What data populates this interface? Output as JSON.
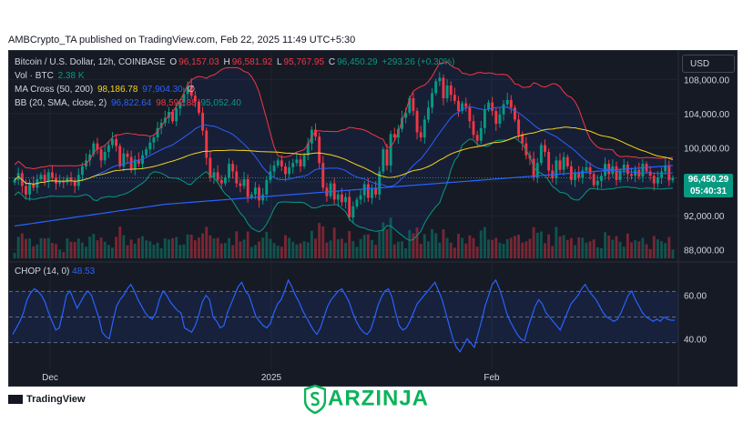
{
  "header": {
    "published": "AMBCrypto_TA published on TradingView.com, Feb 22, 2025 11:49 UTC+5:30"
  },
  "legend": {
    "symbol": "Bitcoin / U.S. Dollar, 12h, COINBASE",
    "o_label": "O",
    "o": "96,157.03",
    "h_label": "H",
    "h": "96,581.92",
    "l_label": "L",
    "l": "95,767.95",
    "c_label": "C",
    "c": "96,450.29",
    "change": "+293.26 (+0.30%)",
    "vol_label": "Vol · BTC",
    "vol": "2.38 K",
    "ma_label": "MA Cross (50, 200)",
    "ma1": "98,186.78",
    "ma2": "97,904.30",
    "ma3": "∅",
    "bb_label": "BB (20, SMA, close, 2)",
    "bb1": "96,822.64",
    "bb2": "98,592.88",
    "bb3": "95,052.40",
    "chop_label": "CHOP (14, 0)",
    "chop": "48.53"
  },
  "currency_button": "USD",
  "price_tag": {
    "price": "96,450.29",
    "countdown": "05:40:31"
  },
  "footer": {
    "tv": "TradingView",
    "brand": "ARZINJA"
  },
  "colors": {
    "up": "#089981",
    "down": "#f23645",
    "ma_fast": "#f7d41d",
    "ma_slow": "#2962ff",
    "bb_upper": "#f23645",
    "bb_lower": "#089981",
    "bb_basis": "#2962ff",
    "chop": "#2962ff",
    "brand": "#0bb35a"
  },
  "chart_data": [
    {
      "type": "candlestick",
      "title": "Bitcoin / U.S. Dollar, 12h, COINBASE",
      "x_ticks": [
        "Dec",
        "2025",
        "Feb"
      ],
      "y_ticks": [
        "108,000.00",
        "104,000.00",
        "100,000.00",
        "96,000.00",
        "92,000.00",
        "88,000.00"
      ],
      "ylim": [
        87000,
        110500
      ],
      "closes": [
        96200,
        97000,
        95500,
        94500,
        95800,
        95300,
        96300,
        96800,
        96100,
        97100,
        96500,
        95800,
        96000,
        95900,
        96500,
        96100,
        95500,
        96800,
        97800,
        98500,
        99200,
        100500,
        99800,
        98500,
        99500,
        100300,
        101000,
        100200,
        97800,
        99300,
        98900,
        97500,
        98600,
        98100,
        99100,
        99800,
        100600,
        101200,
        102300,
        102900,
        103500,
        104200,
        103100,
        104600,
        105300,
        106300,
        107300,
        106100,
        105400,
        104100,
        102000,
        98800,
        96500,
        97100,
        96200,
        95800,
        96500,
        98100,
        97200,
        95800,
        95500,
        96300,
        94200,
        94500,
        95300,
        93800,
        94500,
        96200,
        97200,
        97900,
        98500,
        97800,
        96900,
        97700,
        98200,
        98600,
        97800,
        99100,
        100500,
        102100,
        101300,
        98200,
        95300,
        94300,
        95800,
        93900,
        94500,
        93600,
        94200,
        91800,
        93100,
        93900,
        94400,
        95700,
        94100,
        95200,
        94500,
        97200,
        99800,
        97900,
        101600,
        101200,
        102200,
        103500,
        104100,
        105800,
        104300,
        101800,
        101200,
        103300,
        104700,
        106400,
        107800,
        108200,
        105800,
        107300,
        106200,
        105500,
        104300,
        105200,
        104800,
        103100,
        101500,
        100800,
        102300,
        104500,
        105300,
        104300,
        102800,
        103900,
        105100,
        105600,
        104700,
        103300,
        101500,
        100500,
        99100,
        98700,
        96500,
        98200,
        100300,
        99500,
        97300,
        96400,
        98500,
        97400,
        98900,
        97800,
        96200,
        97100,
        96500,
        97300,
        97700,
        96900,
        95600,
        96100,
        96700,
        98100,
        96900,
        97800,
        96200,
        97300,
        98000,
        96900,
        96700,
        97400,
        96600,
        98100,
        97200,
        96700,
        95800,
        96500,
        97200,
        97900,
        96157,
        96450
      ],
      "volume_note": "Vol · BTC 2.38 K"
    },
    {
      "type": "line",
      "title": "CHOP (14, 0)",
      "y_ticks": [
        "60.00",
        "40.00"
      ],
      "ylim": [
        28,
        72
      ],
      "levels": [
        61.8,
        50,
        38.2
      ],
      "values": [
        42,
        45,
        48,
        52,
        58,
        61,
        63,
        62,
        60,
        57,
        52,
        48,
        44,
        45,
        52,
        60,
        62,
        58,
        54,
        57,
        60,
        62,
        60,
        55,
        50,
        43,
        41,
        40,
        48,
        55,
        58,
        60,
        63,
        65,
        62,
        58,
        55,
        52,
        50,
        49,
        52,
        58,
        62,
        60,
        57,
        55,
        53,
        52,
        45,
        44,
        43,
        46,
        51,
        57,
        60,
        58,
        50,
        48,
        45,
        46,
        52,
        56,
        60,
        64,
        66,
        62,
        60,
        55,
        50,
        48,
        46,
        45,
        47,
        52,
        56,
        58,
        62,
        67,
        64,
        60,
        57,
        53,
        50,
        47,
        44,
        42,
        45,
        50,
        55,
        58,
        60,
        62,
        63,
        60,
        57,
        52,
        48,
        45,
        43,
        42,
        44,
        49,
        55,
        59,
        62,
        63,
        59,
        52,
        46,
        44,
        45,
        48,
        52,
        56,
        58,
        60,
        62,
        64,
        66,
        62,
        58,
        52,
        46,
        40,
        36,
        34,
        37,
        40,
        38,
        36,
        42,
        48,
        55,
        60,
        65,
        67,
        63,
        58,
        52,
        48,
        45,
        42,
        40,
        39,
        45,
        50,
        55,
        58,
        56,
        52,
        50,
        48,
        46,
        44,
        48,
        52,
        56,
        58,
        60,
        63,
        65,
        62,
        60,
        58,
        55,
        52,
        50,
        49,
        48,
        49,
        52,
        56,
        60,
        62,
        58,
        55,
        52,
        50,
        49,
        48,
        49,
        48,
        50,
        49,
        48.5,
        48.53
      ]
    }
  ]
}
